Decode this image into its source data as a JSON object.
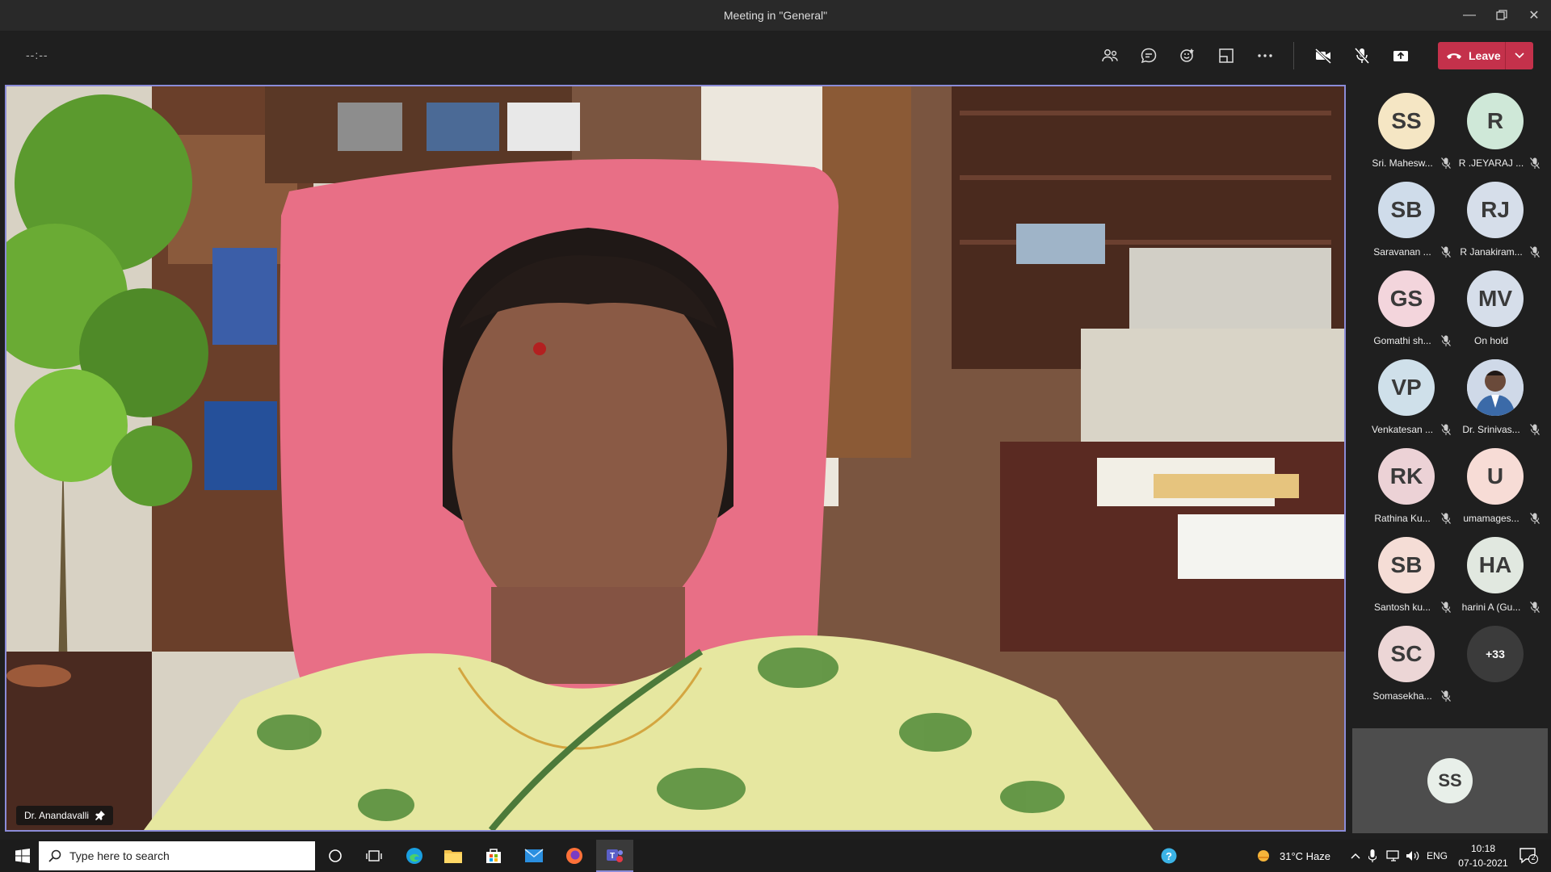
{
  "window": {
    "title": "Meeting in \"General\""
  },
  "toolbar": {
    "timer": "--:--",
    "leave_label": "Leave",
    "icons": [
      "people-icon",
      "chat-icon",
      "reactions-icon",
      "rooms-icon",
      "more-icon",
      "camera-off-icon",
      "mic-off-icon",
      "share-icon"
    ]
  },
  "stage": {
    "presenter_name": "Dr. Anandavalli"
  },
  "roster": {
    "participants": [
      {
        "initials": "SS",
        "name": "Sri. Mahesw...",
        "color": "#f5e6c4"
      },
      {
        "initials": "R",
        "name": "R .JEYARAJ ...",
        "color": "#cfe8d8"
      },
      {
        "initials": "SB",
        "name": "Saravanan ...",
        "color": "#cfdcea"
      },
      {
        "initials": "RJ",
        "name": "R Janakiram...",
        "color": "#d6deea"
      },
      {
        "initials": "GS",
        "name": "Gomathi sh...",
        "color": "#f3d5dc"
      },
      {
        "initials": "MV",
        "name": "On hold",
        "color": "#d6deea"
      },
      {
        "initials": "VP",
        "name": "Venkatesan ...",
        "color": "#cfe0ea"
      },
      {
        "initials": "",
        "name": "Dr. Srinivas...",
        "color": "#b9c7d8"
      },
      {
        "initials": "RK",
        "name": "Rathina Ku...",
        "color": "#ecd2d6"
      },
      {
        "initials": "U",
        "name": "umamages...",
        "color": "#f7dcd6"
      },
      {
        "initials": "SB",
        "name": "Santosh ku...",
        "color": "#f5ddd6"
      },
      {
        "initials": "HA",
        "name": "harini A (Gu...",
        "color": "#e1e8e0"
      },
      {
        "initials": "SC",
        "name": "Somasekha...",
        "color": "#ecd6d6"
      },
      {
        "initials": "+33",
        "name": "",
        "color": "#3b3b3b"
      }
    ]
  },
  "selfview": {
    "initials": "SS"
  },
  "taskbar": {
    "search_placeholder": "Type here to search",
    "weather": "31°C  Haze",
    "lang": "ENG",
    "time": "10:18",
    "date": "07-10-2021",
    "notifications": "2"
  }
}
